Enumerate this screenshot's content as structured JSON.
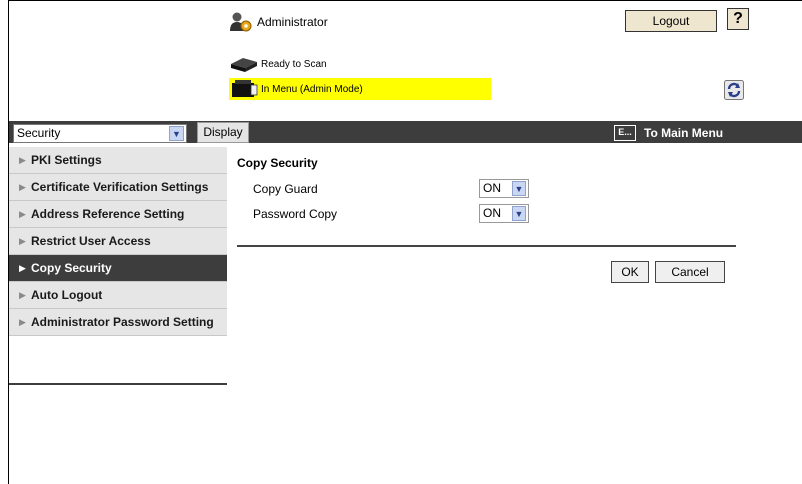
{
  "header": {
    "user_label": "Administrator",
    "logout_label": "Logout",
    "help_label": "?",
    "status_ready": "Ready to Scan",
    "status_menu": "In Menu (Admin Mode)",
    "status_menu_bg": "#ffff00"
  },
  "toolbar": {
    "category_value": "Security",
    "display_label": "Display",
    "to_main_label": "To Main Menu",
    "to_main_icon_text": "E...",
    "bar_color": "#3d3d3d"
  },
  "sidebar": {
    "items": [
      {
        "label": "PKI Settings",
        "active": false
      },
      {
        "label": "Certificate Verification Settings",
        "active": false
      },
      {
        "label": "Address Reference Setting",
        "active": false
      },
      {
        "label": "Restrict User Access",
        "active": false
      },
      {
        "label": "Copy Security",
        "active": true
      },
      {
        "label": "Auto Logout",
        "active": false
      },
      {
        "label": "Administrator Password Setting",
        "active": false
      }
    ]
  },
  "main": {
    "title": "Copy Security",
    "fields": [
      {
        "label": "Copy Guard",
        "value": "ON"
      },
      {
        "label": "Password Copy",
        "value": "ON"
      }
    ],
    "ok_label": "OK",
    "cancel_label": "Cancel"
  }
}
